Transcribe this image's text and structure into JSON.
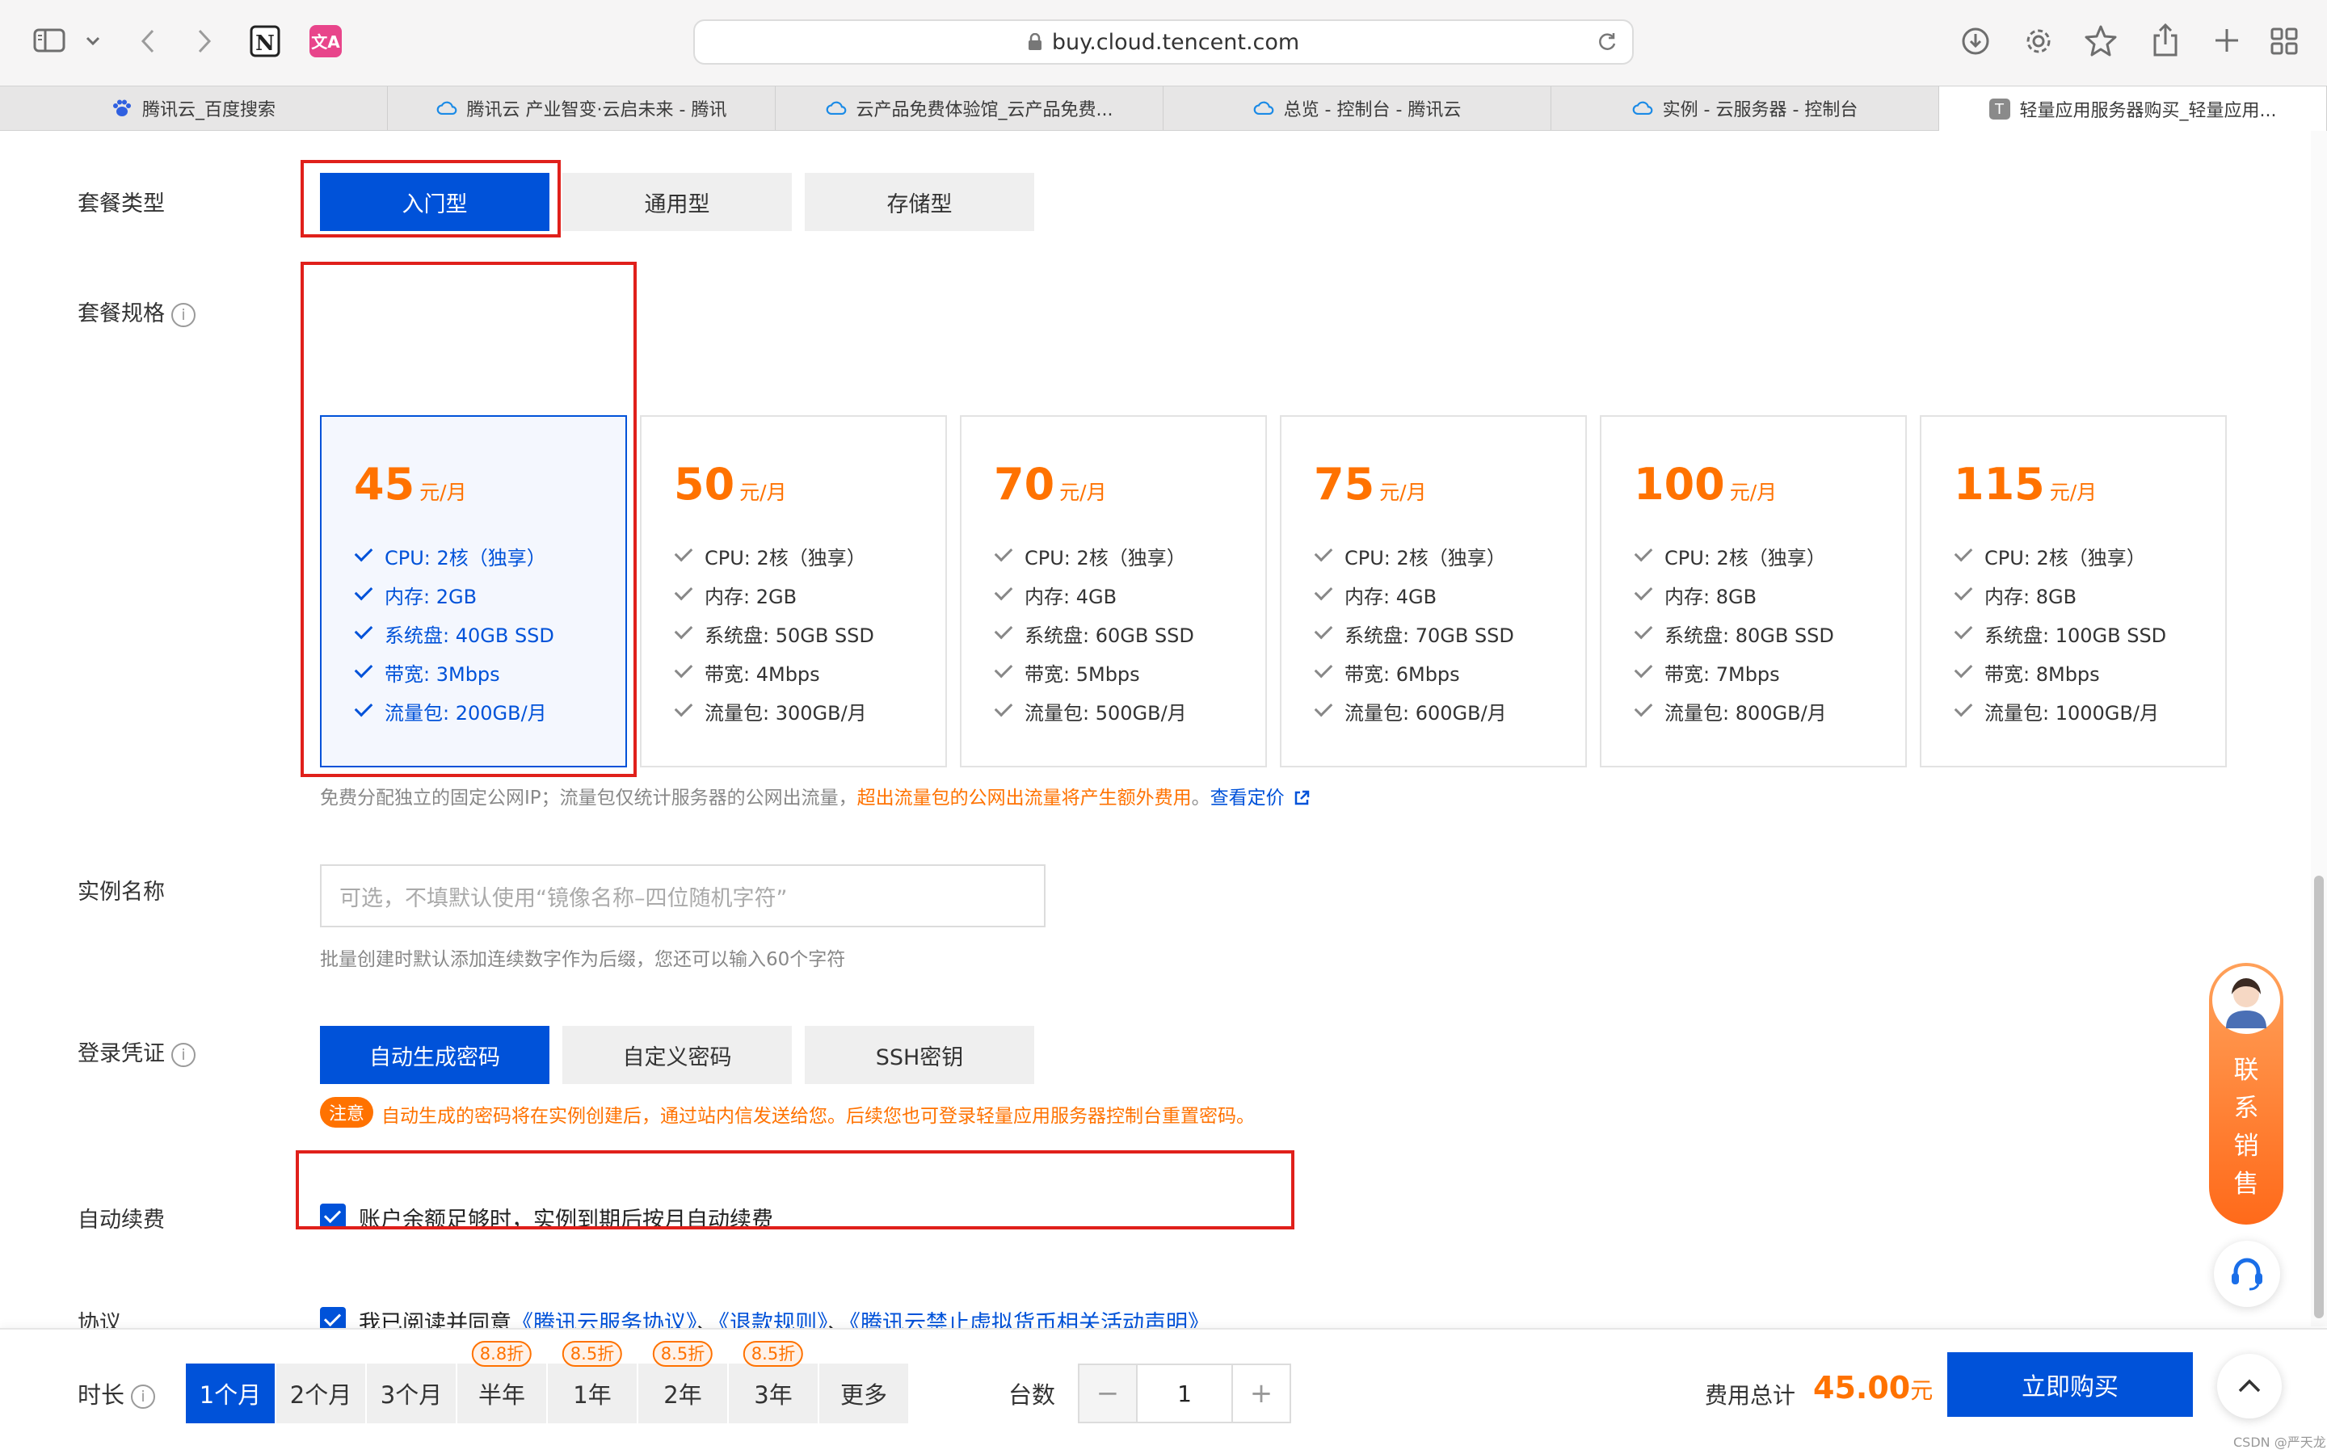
{
  "browser": {
    "url": "buy.cloud.tencent.com",
    "tabs": [
      {
        "label": "腾讯云_百度搜索",
        "favicon": "baidu-paw"
      },
      {
        "label": "腾讯云 产业智变·云启未来 - 腾讯",
        "favicon": "tencent-cloud"
      },
      {
        "label": "云产品免费体验馆_云产品免费...",
        "favicon": "tencent-cloud"
      },
      {
        "label": "总览 - 控制台 - 腾讯云",
        "favicon": "tencent-cloud"
      },
      {
        "label": "实例 - 云服务器 - 控制台",
        "favicon": "tencent-cloud"
      },
      {
        "label": "轻量应用服务器购买_轻量应用...",
        "favicon": "T",
        "active": true
      }
    ]
  },
  "plan_type": {
    "label": "套餐类型",
    "options": [
      "入门型",
      "通用型",
      "存储型"
    ],
    "selected": "入门型"
  },
  "plan_spec": {
    "label": "套餐规格",
    "info_glyph": "i",
    "unit": "元/月",
    "cards": [
      {
        "price": "45",
        "selected": true,
        "specs": [
          "CPU: 2核（独享）",
          "内存: 2GB",
          "系统盘: 40GB SSD",
          "带宽: 3Mbps",
          "流量包: 200GB/月"
        ]
      },
      {
        "price": "50",
        "specs": [
          "CPU: 2核（独享）",
          "内存: 2GB",
          "系统盘: 50GB SSD",
          "带宽: 4Mbps",
          "流量包: 300GB/月"
        ]
      },
      {
        "price": "70",
        "specs": [
          "CPU: 2核（独享）",
          "内存: 4GB",
          "系统盘: 60GB SSD",
          "带宽: 5Mbps",
          "流量包: 500GB/月"
        ]
      },
      {
        "price": "75",
        "specs": [
          "CPU: 2核（独享）",
          "内存: 4GB",
          "系统盘: 70GB SSD",
          "带宽: 6Mbps",
          "流量包: 600GB/月"
        ]
      },
      {
        "price": "100",
        "specs": [
          "CPU: 2核（独享）",
          "内存: 8GB",
          "系统盘: 80GB SSD",
          "带宽: 7Mbps",
          "流量包: 800GB/月"
        ]
      },
      {
        "price": "115",
        "specs": [
          "CPU: 2核（独享）",
          "内存: 8GB",
          "系统盘: 100GB SSD",
          "带宽: 8Mbps",
          "流量包: 1000GB/月"
        ]
      }
    ],
    "note_plain": "免费分配独立的固定公网IP；流量包仅统计服务器的公网出流量，",
    "note_warning": "超出流量包的公网出流量将产生额外费用",
    "note_end": "。",
    "note_link": "查看定价"
  },
  "instance_name": {
    "label": "实例名称",
    "placeholder": "可选，不填默认使用“镜像名称–四位随机字符”",
    "hint": "批量创建时默认添加连续数字作为后缀，您还可以输入60个字符"
  },
  "login": {
    "label": "登录凭证",
    "options": [
      "自动生成密码",
      "自定义密码",
      "SSH密钥"
    ],
    "selected": "自动生成密码",
    "badge": "注意",
    "notice": "自动生成的密码将在实例创建后，通过站内信发送给您。后续您也可登录轻量应用服务器控制台重置密码。"
  },
  "auto_renew": {
    "label": "自动续费",
    "checked": true,
    "text": "账户余额足够时，实例到期后按月自动续费"
  },
  "agreement": {
    "label": "协议",
    "checked": true,
    "prefix": "我已阅读并同意",
    "link1": "《腾讯云服务协议》",
    "sep1": "、",
    "link2": "《退款规则》",
    "sep2": "、",
    "link3": "《腾讯云禁止虚拟货币相关活动声明》"
  },
  "side_widget": {
    "text": [
      "联",
      "系",
      "销",
      "售"
    ]
  },
  "footer": {
    "duration_label": "时长",
    "durations": [
      {
        "label": "1个月",
        "selected": true
      },
      {
        "label": "2个月"
      },
      {
        "label": "3个月"
      },
      {
        "label": "半年",
        "discount": "8.8折"
      },
      {
        "label": "1年",
        "discount": "8.5折"
      },
      {
        "label": "2年",
        "discount": "8.5折"
      },
      {
        "label": "3年",
        "discount": "8.5折"
      },
      {
        "label": "更多"
      }
    ],
    "count_label": "台数",
    "minus": "−",
    "count_value": "1",
    "plus": "+",
    "total_label": "费用总计",
    "total_value": "45.00",
    "total_unit": "元",
    "buy_label": "立即购买"
  },
  "watermark": "CSDN @严天龙",
  "colors": {
    "primary": "#0052d9",
    "price": "#ff7200",
    "highlight_box": "#e0201b"
  }
}
